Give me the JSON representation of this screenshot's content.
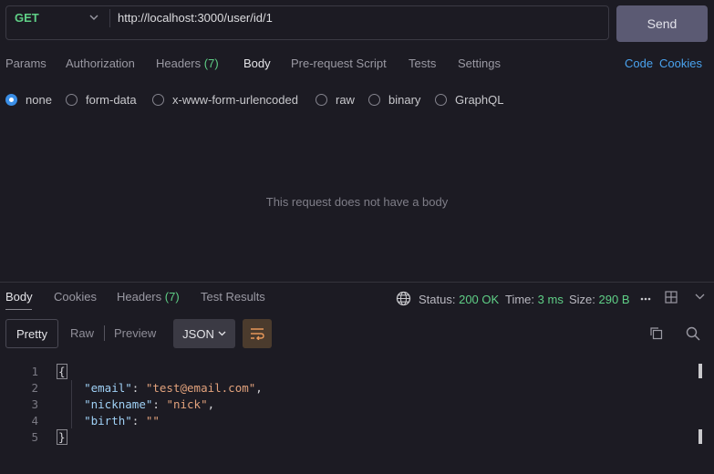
{
  "request": {
    "method": "GET",
    "url": "http://localhost:3000/user/id/1",
    "send_label": "Send",
    "tabs": [
      {
        "label": "Params",
        "count": ""
      },
      {
        "label": "Authorization",
        "count": ""
      },
      {
        "label": "Headers",
        "count": "(7)"
      },
      {
        "label": "Body",
        "count": "",
        "active": true
      },
      {
        "label": "Pre-request Script",
        "count": ""
      },
      {
        "label": "Tests",
        "count": ""
      },
      {
        "label": "Settings",
        "count": ""
      }
    ],
    "links": {
      "code": "Code",
      "cookies": "Cookies"
    },
    "body_types": [
      {
        "label": "none",
        "selected": true
      },
      {
        "label": "form-data"
      },
      {
        "label": "x-www-form-urlencoded"
      },
      {
        "label": "raw"
      },
      {
        "label": "binary"
      },
      {
        "label": "GraphQL"
      }
    ],
    "empty_message": "This request does not have a body"
  },
  "response": {
    "tabs": [
      {
        "label": "Body",
        "count": "",
        "active": true
      },
      {
        "label": "Cookies",
        "count": ""
      },
      {
        "label": "Headers",
        "count": "(7)"
      },
      {
        "label": "Test Results",
        "count": ""
      }
    ],
    "status_label": "Status:",
    "status_value": "200 OK",
    "time_label": "Time:",
    "time_value": "3 ms",
    "size_label": "Size:",
    "size_value": "290 B",
    "views": {
      "pretty": "Pretty",
      "raw": "Raw",
      "preview": "Preview",
      "format": "JSON"
    },
    "code": {
      "line_numbers": [
        "1",
        "2",
        "3",
        "4",
        "5"
      ],
      "open_brace": "{",
      "close_brace": "}",
      "fields": [
        {
          "key": "\"email\"",
          "value": "\"test@email.com\"",
          "comma": ","
        },
        {
          "key": "\"nickname\"",
          "value": "\"nick\"",
          "comma": ","
        },
        {
          "key": "\"birth\"",
          "value": "\"\"",
          "comma": ""
        }
      ]
    }
  },
  "colors": {
    "accent_green": "#5fcf86",
    "link_blue": "#4aa3ef",
    "background": "#1c1b23"
  }
}
